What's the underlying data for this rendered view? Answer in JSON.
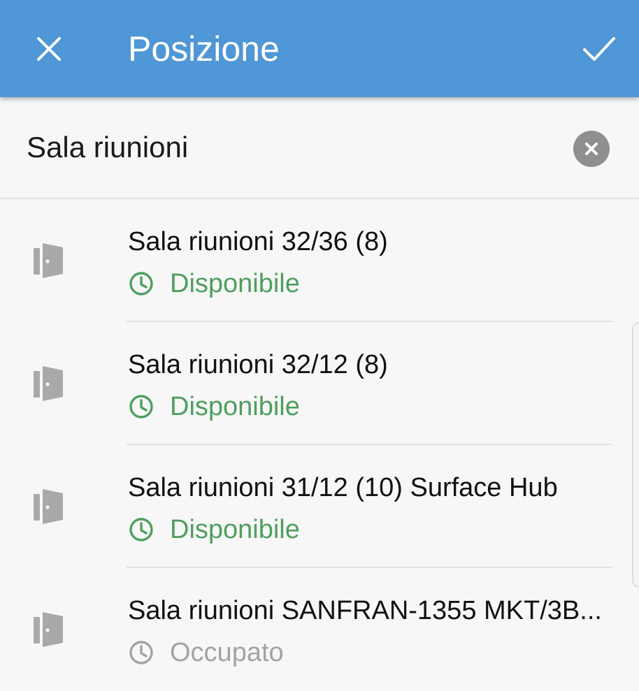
{
  "header": {
    "title": "Posizione",
    "close_icon": "close-icon",
    "confirm_icon": "checkmark-icon",
    "background": "#4f97d6"
  },
  "search": {
    "value": "Sala riunioni",
    "clear_icon": "clear-circle-icon"
  },
  "rooms": [
    {
      "name": "Sala riunioni 32/36 (8)",
      "status": "Disponibile",
      "available": true
    },
    {
      "name": "Sala riunioni 32/12 (8)",
      "status": "Disponibile",
      "available": true
    },
    {
      "name": "Sala riunioni 31/12 (10) Surface Hub",
      "status": "Disponibile",
      "available": true
    },
    {
      "name": "Sala riunioni SANFRAN-1355 MKT/3B...",
      "status": "Occupato",
      "available": false
    }
  ],
  "icons": {
    "room": "door-icon",
    "status": "clock-icon"
  },
  "colors": {
    "available": "#4e9f5e",
    "busy": "#a3a3a3",
    "door": "#a9a9a9"
  }
}
